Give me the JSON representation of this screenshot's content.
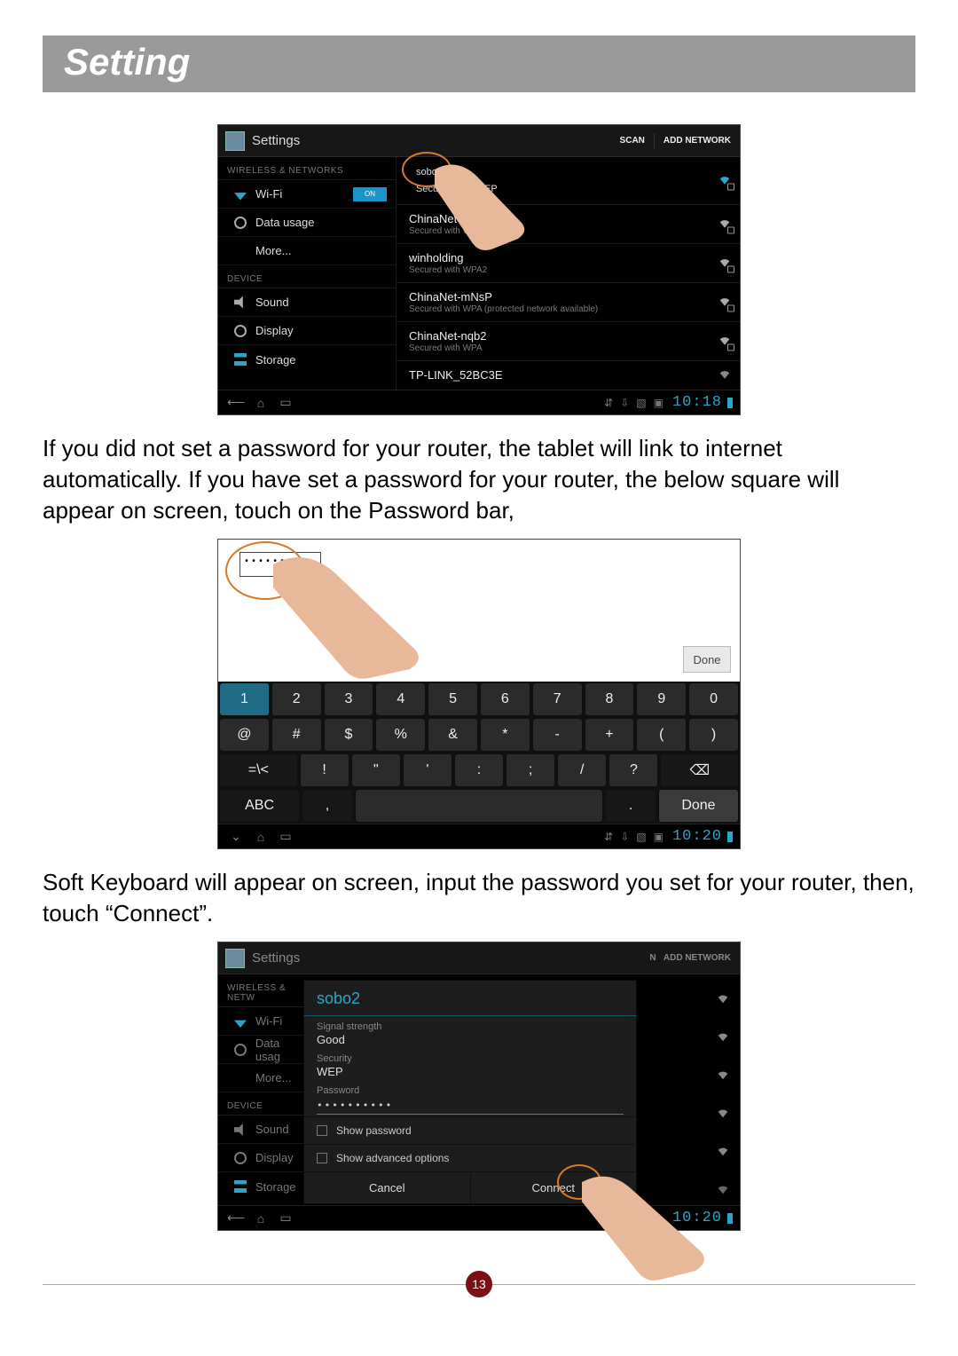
{
  "page": {
    "section_title": "Setting",
    "para1": "If you did not set a password for your router, the tablet will link to internet automatically. If you have set a password for your router, the below square will appear on screen, touch on the Password bar,",
    "para2": "Soft Keyboard will appear on screen, input the password you set for your router, then, touch “Connect”.",
    "page_number": "13"
  },
  "shot1": {
    "title": "Settings",
    "action_scan": "SCAN",
    "action_add": "ADD NETWORK",
    "cat_wireless": "WIRELESS & NETWORKS",
    "cat_device": "DEVICE",
    "menu": {
      "wifi": "Wi-Fi",
      "wifi_toggle": "ON",
      "data_usage": "Data usage",
      "more": "More...",
      "sound": "Sound",
      "display": "Display",
      "storage": "Storage"
    },
    "nets": [
      {
        "name": "sobo2",
        "sub": "Secured with WEP"
      },
      {
        "name": "ChinaNet",
        "sub": "Secured with W"
      },
      {
        "name": "winholding",
        "sub": "Secured with WPA2"
      },
      {
        "name": "ChinaNet-mNsP",
        "sub": "Secured with WPA (protected network available)"
      },
      {
        "name": "ChinaNet-nqb2",
        "sub": "Secured with WPA"
      },
      {
        "name": "TP-LINK_52BC3E",
        "sub": ""
      }
    ],
    "clock": "10:18"
  },
  "shot2": {
    "password_dots": "••••••••",
    "done": "Done",
    "row1": [
      "1",
      "2",
      "3",
      "4",
      "5",
      "6",
      "7",
      "8",
      "9",
      "0"
    ],
    "row2": [
      "@",
      "#",
      "$",
      "%",
      "&",
      "*",
      "-",
      "+",
      "(",
      ")"
    ],
    "row3_shift": "=\\<",
    "row3": [
      "!",
      "\"",
      "'",
      ":",
      ";",
      "/",
      "?"
    ],
    "row3_back": "⌫",
    "row4_abc": "ABC",
    "row4_comma": ",",
    "row4_period": ".",
    "row4_done": "Done",
    "clock": "10:20"
  },
  "shot3": {
    "title": "Settings",
    "action_add": "ADD NETWORK",
    "cat_wireless": "WIRELESS & NETW",
    "cat_device": "DEVICE",
    "menu": {
      "wifi": "Wi-Fi",
      "data_usage": "Data usag",
      "more": "More...",
      "sound": "Sound",
      "display": "Display",
      "storage": "Storage"
    },
    "dialog": {
      "title": "sobo2",
      "signal_lbl": "Signal strength",
      "signal_val": "Good",
      "security_lbl": "Security",
      "security_val": "WEP",
      "password_lbl": "Password",
      "password_val": "••••••••••",
      "show_pw": "Show password",
      "show_adv": "Show advanced options",
      "cancel": "Cancel",
      "connect": "Connect"
    },
    "clock": "10:20"
  }
}
